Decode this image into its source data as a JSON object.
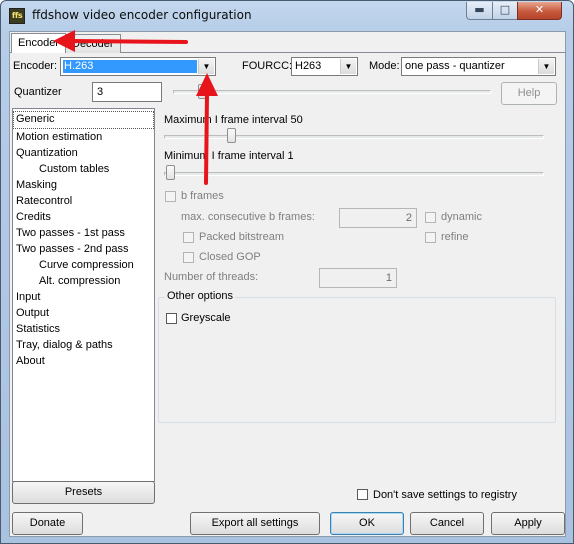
{
  "window": {
    "title": "ffdshow video encoder configuration",
    "icon_text": "ffs",
    "min_glyph": "▬",
    "max_glyph": "□",
    "close_glyph": "✕"
  },
  "tabs": [
    {
      "label": "Encoder",
      "active": true
    },
    {
      "label": "Decoder",
      "active": false
    }
  ],
  "settings_bar": {
    "encoder_label": "Encoder:",
    "encoder_value": "H.263",
    "fourcc_label": "FOURCC:",
    "fourcc_value": "H263",
    "mode_label": "Mode:",
    "mode_value": "one pass - quantizer",
    "quantizer_label": "Quantizer",
    "quantizer_value": "3",
    "help_label": "Help"
  },
  "sidebar": {
    "items": [
      {
        "label": "Generic",
        "selected": true,
        "child": false
      },
      {
        "label": "Motion estimation",
        "child": false
      },
      {
        "label": "Quantization",
        "child": false
      },
      {
        "label": "Custom tables",
        "child": true
      },
      {
        "label": "Masking",
        "child": false
      },
      {
        "label": "Ratecontrol",
        "child": false
      },
      {
        "label": "Credits",
        "child": false
      },
      {
        "label": "Two passes - 1st pass",
        "child": false
      },
      {
        "label": "Two passes - 2nd pass",
        "child": false
      },
      {
        "label": "Curve compression",
        "child": true
      },
      {
        "label": "Alt. compression",
        "child": true
      },
      {
        "label": "Input",
        "child": false
      },
      {
        "label": "Output",
        "child": false
      },
      {
        "label": "Statistics",
        "child": false
      },
      {
        "label": "Tray, dialog & paths",
        "child": false
      },
      {
        "label": "About",
        "child": false
      }
    ],
    "presets_label": "Presets"
  },
  "generic": {
    "max_i_frame_label": "Maximum I frame interval 50",
    "max_i_frame_value": 50,
    "min_i_frame_label": "Minimum I frame interval 1",
    "min_i_frame_value": 1,
    "b_frames_label": "b frames",
    "max_consecutive_label": "max. consecutive b frames:",
    "max_consecutive_value": "2",
    "dynamic_label": "dynamic",
    "packed_label": "Packed bitstream",
    "refine_label": "refine",
    "closed_gop_label": "Closed GOP",
    "threads_label": "Number of threads:",
    "threads_value": "1",
    "other_options_label": "Other options",
    "greyscale_label": "Greyscale"
  },
  "footer": {
    "dont_save_label": "Don't save settings to registry",
    "donate_label": "Donate",
    "export_label": "Export all settings",
    "ok_label": "OK",
    "cancel_label": "Cancel",
    "apply_label": "Apply"
  },
  "colors": {
    "annotation_arrow": "#e8141b",
    "selection_blue": "#3399ff",
    "dialog_bg": "#f0f0f0"
  }
}
